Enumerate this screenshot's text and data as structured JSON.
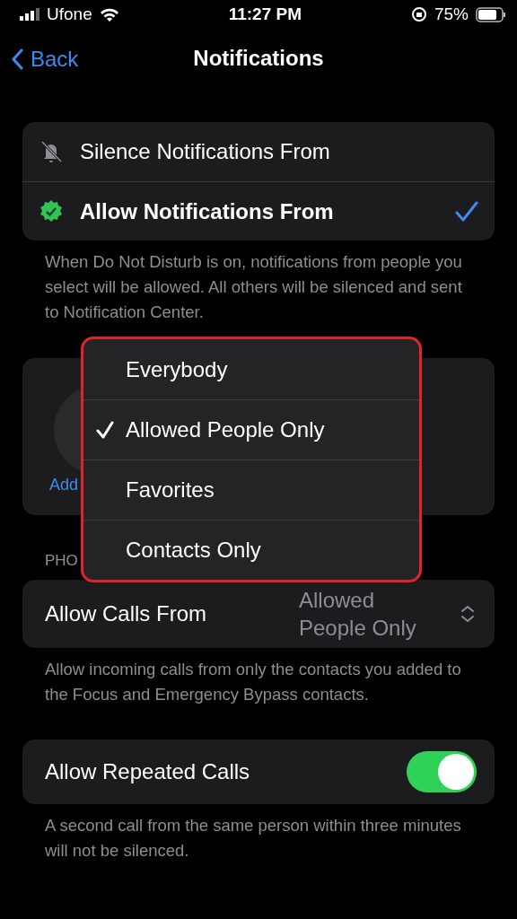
{
  "status_bar": {
    "carrier": "Ufone",
    "time": "11:27 PM",
    "battery": "75%"
  },
  "nav": {
    "back": "Back",
    "title": "Notifications"
  },
  "mode_options": [
    {
      "label": "Silence Notifications From",
      "kind": "silence",
      "selected": false
    },
    {
      "label": "Allow Notifications From",
      "kind": "allow",
      "selected": true
    }
  ],
  "mode_caption": "When Do Not Disturb is on, notifications from people you select will be allowed. All others will be silenced and sent to Notification Center.",
  "people_card": {
    "add_label": "Add"
  },
  "phone_header": "PHO",
  "calls_menu": [
    {
      "label": "Everybody",
      "selected": false
    },
    {
      "label": "Allowed People Only",
      "selected": true
    },
    {
      "label": "Favorites",
      "selected": false
    },
    {
      "label": "Contacts Only",
      "selected": false
    }
  ],
  "allow_calls": {
    "label": "Allow Calls From",
    "value": "Allowed People Only"
  },
  "calls_caption": "Allow incoming calls from only the contacts you added to the Focus and Emergency Bypass contacts.",
  "repeated": {
    "label": "Allow Repeated Calls",
    "on": true
  },
  "repeated_caption": "A second call from the same person within three minutes will not be silenced."
}
